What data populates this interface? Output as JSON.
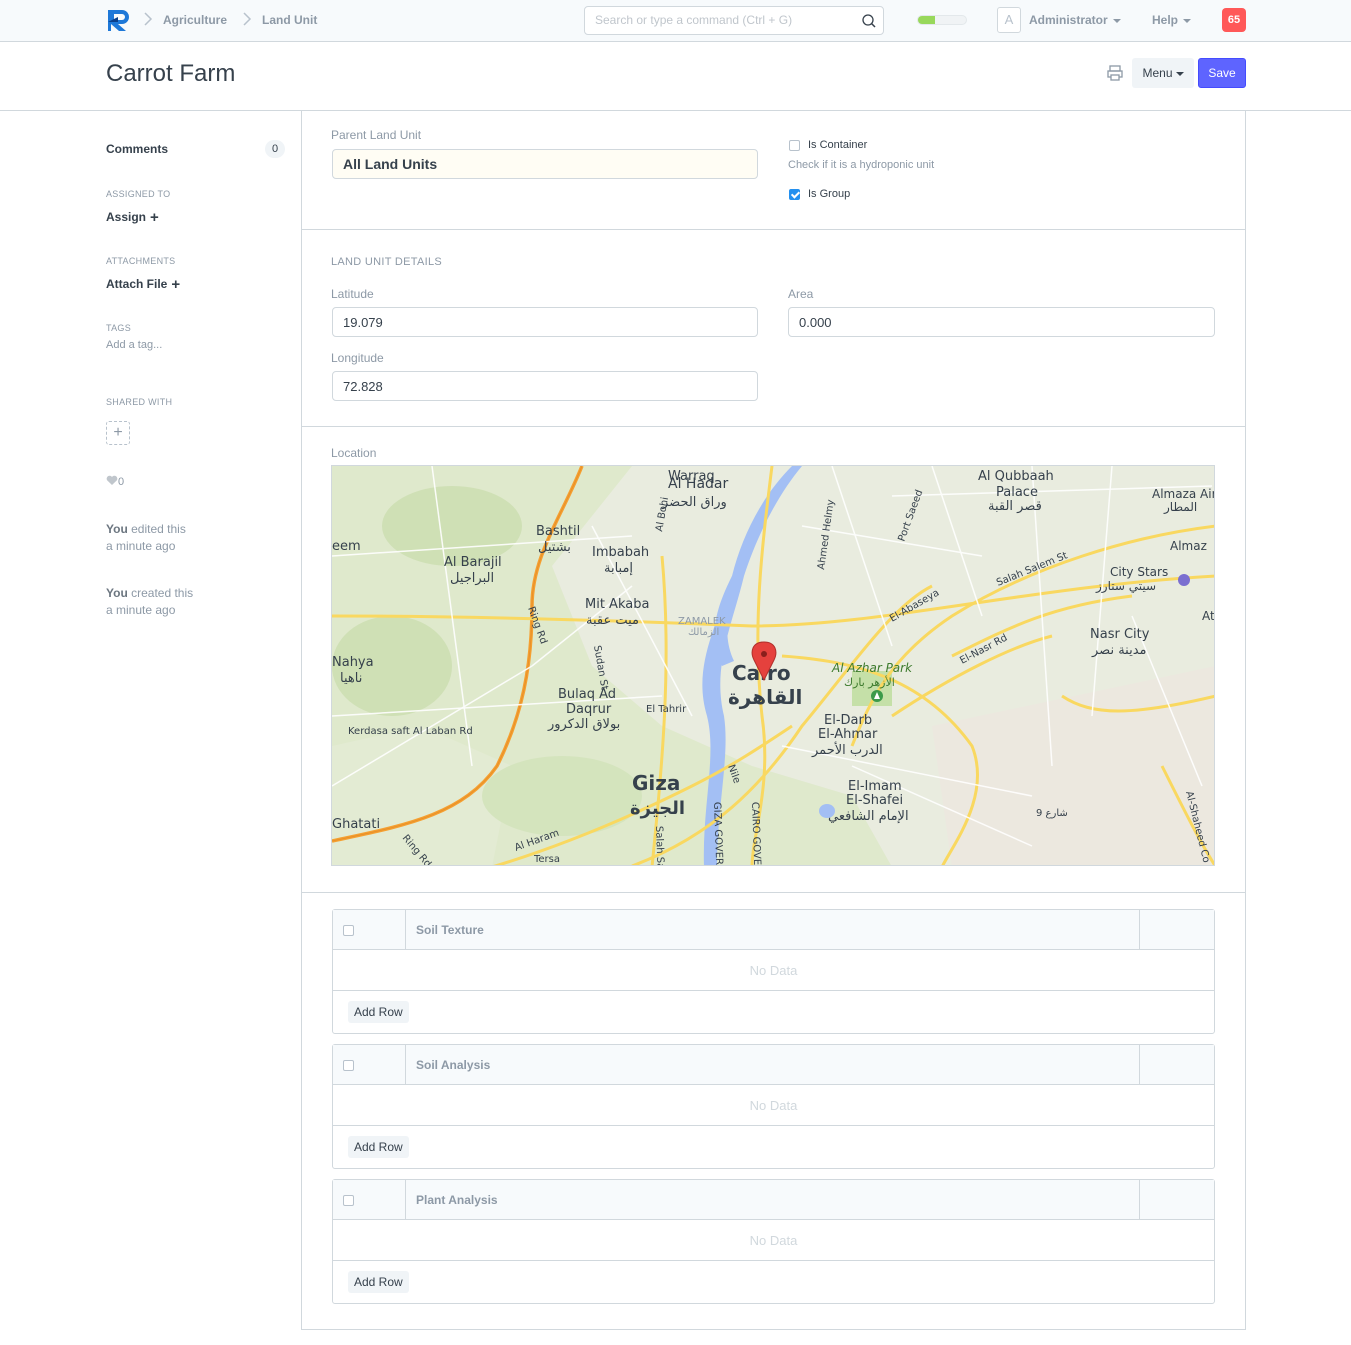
{
  "navbar": {
    "breadcrumbs": [
      "Agriculture",
      "Land Unit"
    ],
    "search_placeholder": "Search or type a command (Ctrl + G)",
    "progress": 0.35,
    "avatar_letter": "A",
    "user": "Administrator",
    "help": "Help",
    "notifications": "65",
    "colors": {
      "progress": "#98d85b",
      "notif": "#ff5858",
      "primary": "#5e64ff"
    }
  },
  "page": {
    "title": "Carrot Farm",
    "menu_label": "Menu",
    "save_label": "Save"
  },
  "sidebar": {
    "comments_label": "Comments",
    "comments_count": "0",
    "assigned_to_label": "ASSIGNED TO",
    "assign_label": "Assign",
    "attachments_label": "ATTACHMENTS",
    "attach_label": "Attach File",
    "tags_label": "TAGS",
    "tag_placeholder": "Add a tag...",
    "shared_with_label": "SHARED WITH",
    "likes": "0",
    "activity": [
      {
        "who": "You",
        "what": " edited this",
        "when": "a minute ago"
      },
      {
        "who": "You",
        "what": " created this",
        "when": "a minute ago"
      }
    ]
  },
  "form": {
    "parent_land_unit_label": "Parent Land Unit",
    "parent_land_unit_value": "All Land Units",
    "is_container_label": "Is Container",
    "is_container_checked": false,
    "is_container_help": "Check if it is a hydroponic unit",
    "is_group_label": "Is Group",
    "is_group_checked": true,
    "details_heading": "LAND UNIT DETAILS",
    "latitude_label": "Latitude",
    "latitude_value": "19.079",
    "longitude_label": "Longitude",
    "longitude_value": "72.828",
    "area_label": "Area",
    "area_value": "0.000",
    "location_label": "Location",
    "map_labels": {
      "cairo": "Cairo",
      "cairo_ar": "القاهرة",
      "giza": "Giza",
      "giza_ar": "الجيزة",
      "hadar": "Al Hadar",
      "hadar_ar": "وراق الحضر",
      "warraq": "Warraq",
      "bashtil": "Bashtil",
      "bashtil_ar": "بشتيل",
      "imbabah": "Imbabah",
      "imbabah_ar": "إمبابة",
      "barajil": "Al Barajil",
      "barajil_ar": "البراجيل",
      "mitakaba": "Mit Akaba",
      "mitakaba_ar": "ميت عقبة",
      "zamalek": "ZAMALEK",
      "zamalek_ar": "الزمالك",
      "nahya": "Nahya",
      "nahya_ar": "ناهيا",
      "bulaq": "Bulaq Ad",
      "daqrur": "Daqrur",
      "bulaq_ar": "بولاق الدكرور",
      "kerdasa": "Kerdasa saft Al Laban Rd",
      "ringrd": "Ring Rd",
      "sudanst": "Sudan St",
      "eltahrir": "El Tahrir",
      "azhar": "Al Azhar Park",
      "azhar_ar": "الأزهر بارك",
      "darb": "El-Darb",
      "ahmar": "El-Ahmar",
      "darb_ar": "الدرب الأحمر",
      "imam": "El-Imam",
      "shafei": "El-Shafei",
      "imam_ar": "الإمام الشافعي",
      "qubbaah": "Al Qubbaah",
      "palace": "Palace",
      "qubbaah_ar": "قصر القبة",
      "almaza": "Almaza Airp",
      "almaza_ar": "المطار",
      "citystars": "City Stars",
      "citystars_ar": "سيتي ستارز",
      "nasrcity": "Nasr City",
      "nasrcity_ar": "مدينة نصر",
      "salahsalem": "Salah Salem St",
      "elnasr": "El-Nasr Rd",
      "abaseya": "El-Abaseya",
      "portsaeed": "Port Saeed",
      "ahmedhelmy": "Ahmed Helmy",
      "alharam": "Al Haram",
      "tersa": "Tersa",
      "nile": "Nile",
      "ghatati": "Ghatati",
      "eem": "eem",
      "alshaheed": "Al-Shaheed Co",
      "almaza2": "Almaz",
      "ath": "Ath",
      "albohi": "Al Bohi",
      "salahsa": "Salah Sa",
      "gizagover": "GIZA GOVER",
      "cairogover": "CAIRO GOVER",
      "street9": "شارع 9"
    },
    "tables": [
      {
        "title": "Soil Texture",
        "empty": "No Data",
        "add_row": "Add Row"
      },
      {
        "title": "Soil Analysis",
        "empty": "No Data",
        "add_row": "Add Row"
      },
      {
        "title": "Plant Analysis",
        "empty": "No Data",
        "add_row": "Add Row"
      }
    ]
  }
}
